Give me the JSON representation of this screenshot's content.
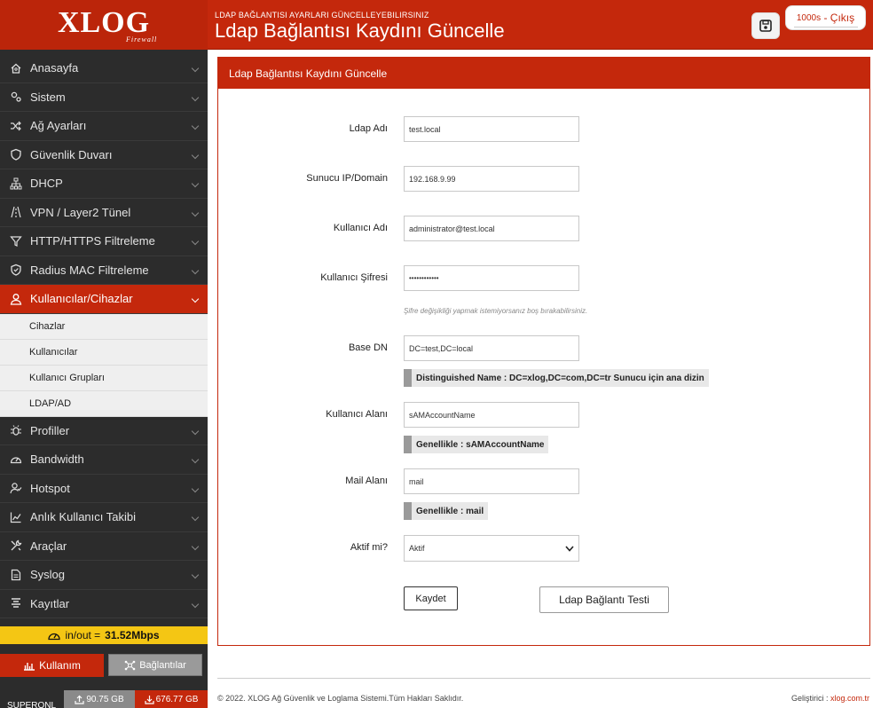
{
  "header": {
    "logo_text": "XLOG",
    "logo_sub": "Firewall",
    "subtitle": "LDAP BAĞLANTISI AYARLARI GÜNCELLEYEBILIRSINIZ",
    "title": "Ldap Bağlantısı Kaydını Güncelle",
    "timer": "1000s",
    "exit_sep": " - ",
    "exit_label": "Çıkış"
  },
  "sidebar": {
    "items": [
      {
        "label": "Anasayfa",
        "icon": "home-icon"
      },
      {
        "label": "Sistem",
        "icon": "gears-icon"
      },
      {
        "label": "Ağ Ayarları",
        "icon": "shuffle-icon"
      },
      {
        "label": "Güvenlik Duvarı",
        "icon": "shield-icon"
      },
      {
        "label": "DHCP",
        "icon": "sitemap-icon"
      },
      {
        "label": "VPN / Layer2 Tünel",
        "icon": "road-icon"
      },
      {
        "label": "HTTP/HTTPS Filtreleme",
        "icon": "filter-icon"
      },
      {
        "label": "Radius MAC Filtreleme",
        "icon": "shield-check-icon"
      },
      {
        "label": "Kullanıcılar/Cihazlar",
        "icon": "user-icon"
      }
    ],
    "sub_items": [
      "Cihazlar",
      "Kullanıcılar",
      "Kullanıcı Grupları",
      "LDAP/AD"
    ],
    "items_after": [
      {
        "label": "Profiller",
        "icon": "bug-icon"
      },
      {
        "label": "Bandwidth",
        "icon": "gauge-icon"
      },
      {
        "label": "Hotspot",
        "icon": "user-check-icon"
      },
      {
        "label": "Anlık Kullanıcı Takibi",
        "icon": "chart-line-icon"
      },
      {
        "label": "Araçlar",
        "icon": "tools-icon"
      },
      {
        "label": "Syslog",
        "icon": "file-icon"
      },
      {
        "label": "Kayıtlar",
        "icon": "list-icon"
      }
    ],
    "io_label": "in/out =",
    "io_value": "31.52Mbps",
    "usage_label": "Kullanım",
    "connections_label": "Bağlantılar",
    "footer_text": "SUPERONL",
    "upload": "90.75 GB",
    "download": "676.77 GB"
  },
  "panel": {
    "title": "Ldap Bağlantısı Kaydını Güncelle",
    "fields": {
      "ldap_name": {
        "label": "Ldap Adı",
        "value": "test.local"
      },
      "server": {
        "label": "Sunucu IP/Domain",
        "value": "192.168.9.99"
      },
      "username": {
        "label": "Kullanıcı Adı",
        "value": "administrator@test.local"
      },
      "password": {
        "label": "Kullanıcı Şifresi",
        "value": "••••••••••••",
        "hint": "Şifre değişikliği yapmak istemiyorsanız boş bırakabilirsiniz."
      },
      "base_dn": {
        "label": "Base DN",
        "value": "DC=test,DC=local",
        "tip": "Distinguished Name : DC=xlog,DC=com,DC=tr Sunucu için ana dizin"
      },
      "user_field": {
        "label": "Kullanıcı Alanı",
        "value": "sAMAccountName",
        "tip": "Genellikle : sAMAccountName"
      },
      "mail_field": {
        "label": "Mail Alanı",
        "value": "mail",
        "tip": "Genellikle : mail"
      },
      "active": {
        "label": "Aktif mi?",
        "value": "Aktif"
      }
    },
    "save_label": "Kaydet",
    "test_label": "Ldap Bağlantı Testi"
  },
  "footer": {
    "copyright": "© 2022. XLOG Ağ Güvenlik ve Loglama Sistemi.Tüm Hakları Saklıdır.",
    "dev_label": "Geliştirici :",
    "dev_link": "xlog.com.tr"
  }
}
